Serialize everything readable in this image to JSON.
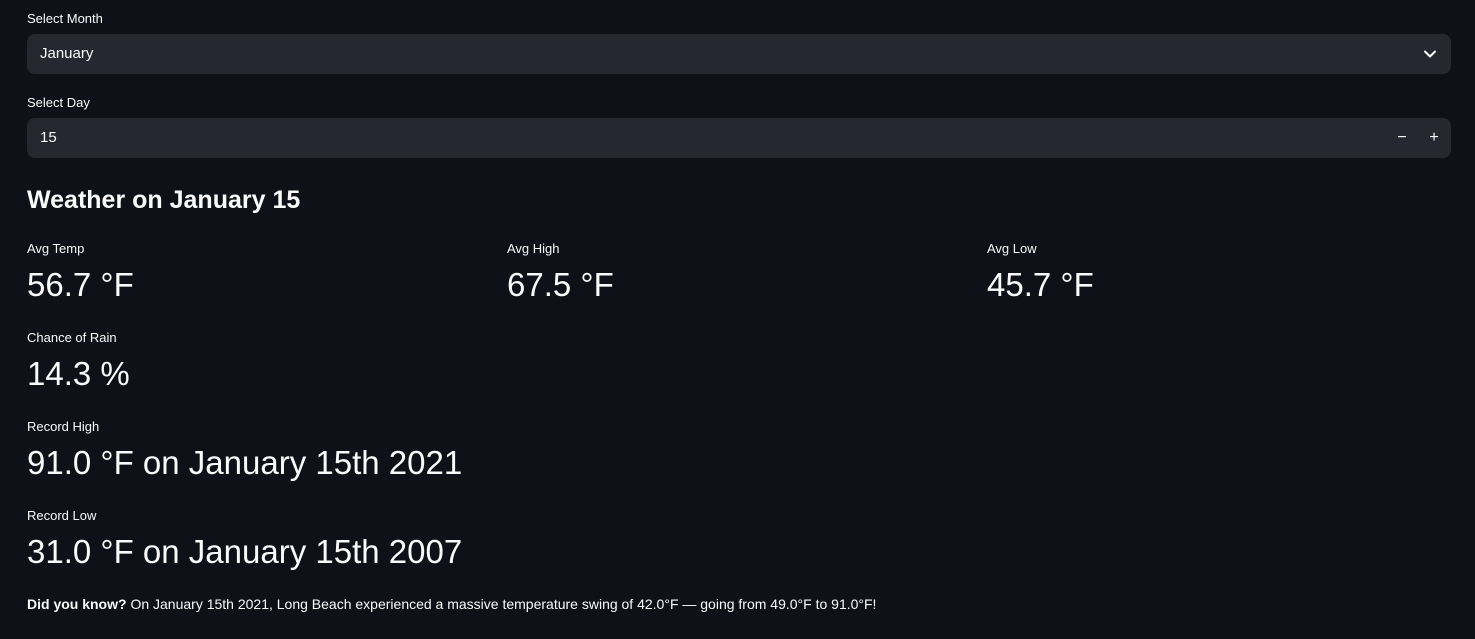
{
  "month_select": {
    "label": "Select Month",
    "value": "January"
  },
  "day_input": {
    "label": "Select Day",
    "value": "15",
    "decrement": "−",
    "increment": "+"
  },
  "heading": "Weather on January 15",
  "metrics": {
    "avg_temp": {
      "label": "Avg Temp",
      "value": "56.7 °F"
    },
    "avg_high": {
      "label": "Avg High",
      "value": "67.5 °F"
    },
    "avg_low": {
      "label": "Avg Low",
      "value": "45.7 °F"
    },
    "rain": {
      "label": "Chance of Rain",
      "value": "14.3 %"
    },
    "record_high": {
      "label": "Record High",
      "value": "91.0 °F on January 15th 2021"
    },
    "record_low": {
      "label": "Record Low",
      "value": "31.0 °F on January 15th 2007"
    }
  },
  "fact": {
    "lead": "Did you know?",
    "text": " On January 15th 2021, Long Beach experienced a massive temperature swing of 42.0°F — going from 49.0°F to 91.0°F!"
  },
  "colors": {
    "background": "#0e1117",
    "input_background": "#262730",
    "text": "#fafafa"
  },
  "icons": {
    "dropdown": "chevron-down-icon"
  }
}
